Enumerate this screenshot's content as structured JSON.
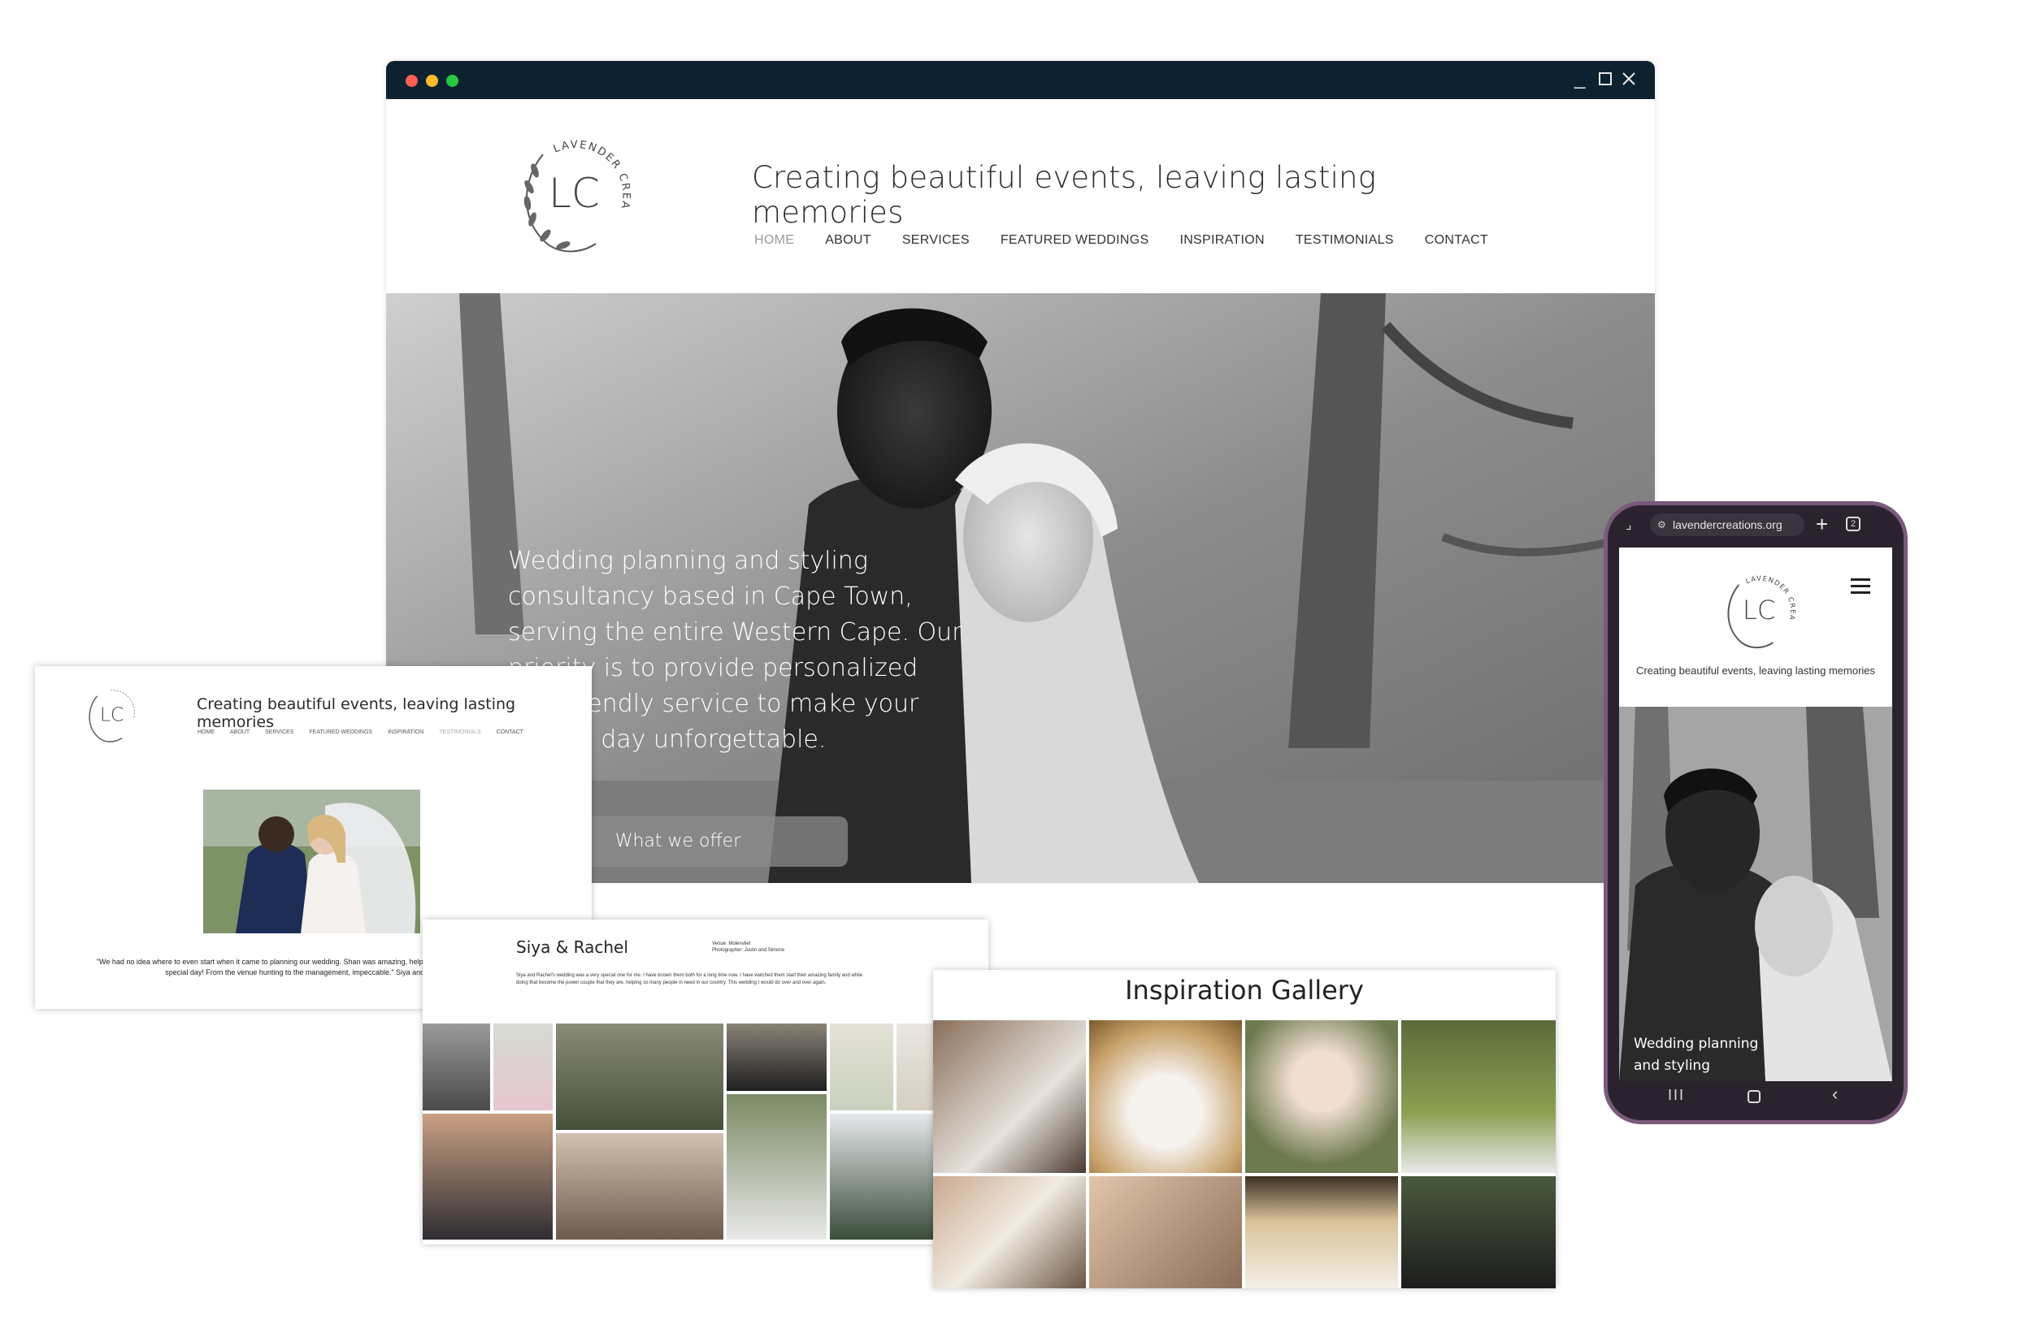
{
  "main_browser": {
    "logo": {
      "monogram": "LC",
      "arc_text": "LAVENDER CREATIONS"
    },
    "tagline": "Creating beautiful events, leaving lasting memories",
    "nav": [
      "HOME",
      "ABOUT",
      "SERVICES",
      "FEATURED WEDDINGS",
      "INSPIRATION",
      "TESTIMONIALS",
      "CONTACT"
    ],
    "active_nav": "HOME",
    "hero_text": "Wedding planning and styling consultancy based in Cape Town, serving the entire Western Cape. Our priority is to provide personalized and friendly service to make your special day unforgettable.",
    "hero_button": "What we offer",
    "titlebar_color": "#0d2230",
    "dot_colors": [
      "#ff5f57",
      "#febc2e",
      "#28c840"
    ],
    "window_controls": [
      "minimize-icon",
      "maximize-icon",
      "close-icon"
    ]
  },
  "testimonial_card": {
    "tagline": "Creating beautiful events, leaving lasting memories",
    "nav": [
      "HOME",
      "ABOUT",
      "SERVICES",
      "FEATURED WEDDINGS",
      "INSPIRATION",
      "TESTIMONIALS",
      "CONTACT"
    ],
    "active_nav": "TESTIMONIALS",
    "quote": "\"We had no idea where to even start when it came to planning our wedding. Shan was amazing, helping us with every detail of our special day! From the venue hunting to the management, impeccable.\"  Siya and Rachel"
  },
  "siya_card": {
    "title": "Siya & Rachel",
    "venue": "Venue: Molenvliet",
    "photographer": "Photographer: Justin and Simone",
    "description": "Siya and Rachel's wedding was a very special one for me. I have known them both for a long time now. I have watched them start their amazing family and while doing that become the power couple that they are, helping so many people in need in our country. This wedding I would do over and over again."
  },
  "inspiration_card": {
    "title": "Inspiration Gallery"
  },
  "phone": {
    "url": "lavendercreations.org",
    "tagline": "Creating beautiful events, leaving lasting memories",
    "hero_text": "Wedding planning and styling consultancy based in Cape Town",
    "menu_icon": "hamburger-icon",
    "nav_icons": [
      "recent-apps-icon",
      "home-icon",
      "back-icon"
    ],
    "frame_color": "#7a5a7a"
  }
}
